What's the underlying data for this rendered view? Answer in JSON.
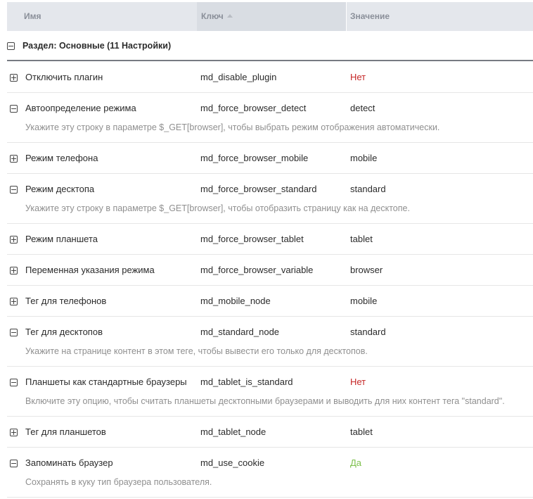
{
  "columns": {
    "name": "Имя",
    "key": "Ключ",
    "value": "Значение",
    "sort_icon": "sort-ascending-icon"
  },
  "section": {
    "label": "Раздел: Основные (11 Настройки)",
    "icon": "collapse-minus-icon"
  },
  "rows": [
    {
      "name": "Отключить плагин",
      "key": "md_disable_plugin",
      "value": "Нет",
      "value_color": "#c62828",
      "expanded": false,
      "description": ""
    },
    {
      "name": "Автоопределение режима",
      "key": "md_force_browser_detect",
      "value": "detect",
      "value_color": "#2b2b2b",
      "expanded": true,
      "description": "Укажите эту строку в параметре $_GET[browser], чтобы выбрать режим отображения автоматически."
    },
    {
      "name": "Режим телефона",
      "key": "md_force_browser_mobile",
      "value": "mobile",
      "value_color": "#2b2b2b",
      "expanded": false,
      "description": ""
    },
    {
      "name": "Режим десктопа",
      "key": "md_force_browser_standard",
      "value": "standard",
      "value_color": "#2b2b2b",
      "expanded": true,
      "description": "Укажите эту строку в параметре $_GET[browser], чтобы отобразить страницу как на десктопе."
    },
    {
      "name": "Режим планшета",
      "key": "md_force_browser_tablet",
      "value": "tablet",
      "value_color": "#2b2b2b",
      "expanded": false,
      "description": ""
    },
    {
      "name": "Переменная указания режима",
      "key": "md_force_browser_variable",
      "value": "browser",
      "value_color": "#2b2b2b",
      "expanded": false,
      "description": ""
    },
    {
      "name": "Тег для телефонов",
      "key": "md_mobile_node",
      "value": "mobile",
      "value_color": "#2b2b2b",
      "expanded": false,
      "description": ""
    },
    {
      "name": "Тег для десктопов",
      "key": "md_standard_node",
      "value": "standard",
      "value_color": "#2b2b2b",
      "expanded": true,
      "description": "Укажите на странице контент в этом теге, чтобы вывести его только для десктопов."
    },
    {
      "name": "Планшеты как стандартные браузеры",
      "key": "md_tablet_is_standard",
      "value": "Нет",
      "value_color": "#c62828",
      "expanded": true,
      "description": "Включите эту опцию, чтобы считать планшеты десктопными браузерами и выводить для них контент тега \"standard\"."
    },
    {
      "name": "Тег для планшетов",
      "key": "md_tablet_node",
      "value": "tablet",
      "value_color": "#2b2b2b",
      "expanded": false,
      "description": ""
    },
    {
      "name": "Запоминать браузер",
      "key": "md_use_cookie",
      "value": "Да",
      "value_color": "#7cbf4a",
      "expanded": true,
      "description": "Сохранять в куку тип браузера пользователя."
    }
  ]
}
